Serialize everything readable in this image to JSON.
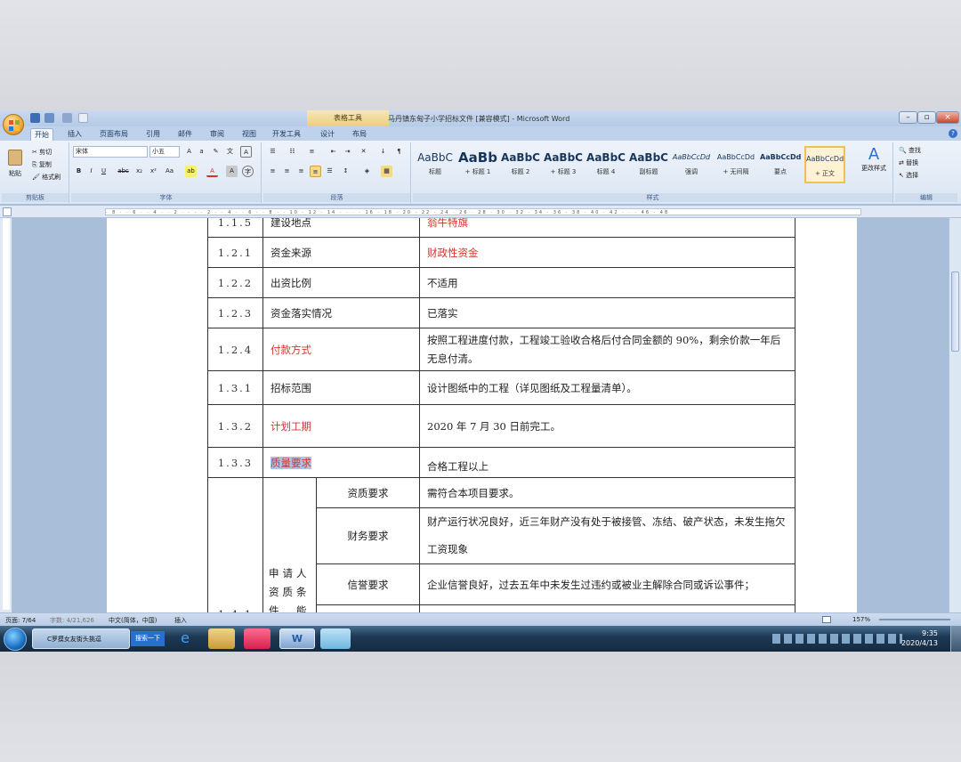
{
  "window": {
    "title": "马丹镇东甸子小学招标文件 [兼容模式] - Microsoft Word",
    "context_tab": "表格工具"
  },
  "ribbon": {
    "tabs": [
      "开始",
      "插入",
      "页面布局",
      "引用",
      "邮件",
      "审阅",
      "视图",
      "开发工具",
      "设计",
      "布局"
    ],
    "clipboard": {
      "paste": "粘贴",
      "cut": "剪切",
      "copy": "复制",
      "format_painter": "格式刷",
      "label": "剪贴板"
    },
    "font": {
      "name": "宋体",
      "size": "小五",
      "label": "字体"
    },
    "paragraph": {
      "label": "段落"
    },
    "styles": {
      "label": "样式",
      "items": [
        {
          "sample": "AaBbC",
          "name": "标题"
        },
        {
          "sample": "AaBb",
          "name": "+ 标题 1"
        },
        {
          "sample": "AaBbC",
          "name": "标题 2"
        },
        {
          "sample": "AaBbC",
          "name": "+ 标题 3"
        },
        {
          "sample": "AaBbC",
          "name": "标题 4"
        },
        {
          "sample": "AaBbC",
          "name": "副标题"
        },
        {
          "sample": "AaBbCcDd",
          "name": "强调"
        },
        {
          "sample": "AaBbCcDd",
          "name": "+ 无间隔"
        },
        {
          "sample": "AaBbCcDd",
          "name": "要点"
        },
        {
          "sample": "AaBbCcDd",
          "name": "+ 正文"
        }
      ],
      "change_styles": "更改样式"
    },
    "editing": {
      "find": "查找",
      "replace": "替换",
      "select": "选择",
      "label": "编辑"
    }
  },
  "document": {
    "rows": [
      {
        "num": "1.1.5",
        "item": "建设地点",
        "value": "翁牛特旗",
        "item_red": false,
        "value_red": true
      },
      {
        "num": "1.2.1",
        "item": "资金来源",
        "value": "财政性资金",
        "item_red": false,
        "value_red": true
      },
      {
        "num": "1.2.2",
        "item": "出资比例",
        "value": "不适用",
        "item_red": false,
        "value_red": false
      },
      {
        "num": "1.2.3",
        "item": "资金落实情况",
        "value": "已落实",
        "item_red": false,
        "value_red": false
      },
      {
        "num": "1.2.4",
        "item": "付款方式",
        "value": "按照工程进度付款，工程竣工验收合格后付合同金额的 90%，剩余价款一年后无息付清。",
        "item_red": true,
        "value_red": false
      },
      {
        "num": "1.3.1",
        "item": "招标范围",
        "value": "设计图纸中的工程（详见图纸及工程量清单）。",
        "item_red": false,
        "value_red": false
      },
      {
        "num": "1.3.2",
        "item": "计划工期",
        "value": "2020 年 7 月 30 日前完工。",
        "item_red": true,
        "value_red": false
      },
      {
        "num": "1.3.3",
        "item": "质量要求",
        "value": "合格工程以上",
        "item_red": true,
        "value_red": false
      }
    ],
    "qualification": {
      "num": "1.4.1",
      "item": "申请人资质条件、能",
      "sub": [
        {
          "label": "资质要求",
          "value": "需符合本项目要求。"
        },
        {
          "label": "财务要求",
          "value": "财产运行状况良好，近三年财产没有处于被接管、冻结、破产状态，未发生拖欠工资现象"
        },
        {
          "label": "信誉要求",
          "value": "企业信誉良好，过去五年中未发生过违约或被业主解除合同或诉讼事件；"
        }
      ]
    }
  },
  "status_bar": {
    "page": "页面: 7/64",
    "words": "字数: 4/21,626",
    "language": "中文(简体，中国)",
    "mode": "插入",
    "zoom": "157%"
  },
  "taskbar": {
    "ie_task": "C罗摸女友街头挑逗",
    "search": "搜索一下",
    "time": "9:35",
    "date": "2020/4/13"
  }
}
